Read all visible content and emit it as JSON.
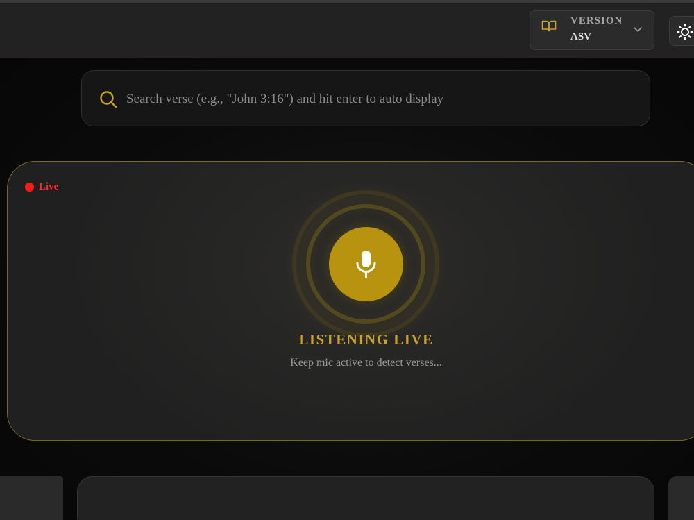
{
  "version": {
    "label": "VERSION",
    "value": "ASV"
  },
  "search": {
    "placeholder": "Search verse (e.g., \"John 3:16\") and hit enter to auto display",
    "value": ""
  },
  "live": {
    "status": "Live",
    "title": "LISTENING LIVE",
    "subtitle": "Keep mic active to detect verses..."
  },
  "icons": {
    "version": "book-icon",
    "dropdown": "chevron-down-icon",
    "theme": "sun-icon",
    "search": "search-icon",
    "mic": "microphone-icon"
  },
  "colors": {
    "accent": "#c9a227",
    "mic": "#b8930f",
    "live": "#ff1a1a",
    "background": "#080808"
  }
}
